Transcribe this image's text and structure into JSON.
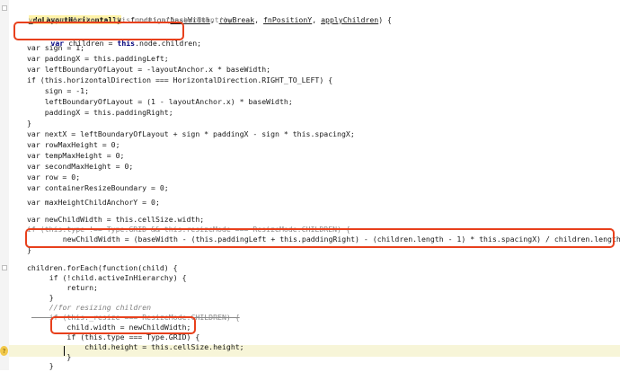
{
  "editor": {
    "lines": {
      "l1": "_doLayoutHorizontally",
      "l1_rest": ": function(",
      "l1_p1": "baseWidth",
      "l1_p2": "rowBreak",
      "l1_p3": "fnPositionY",
      "l1_p4": "applyChildren",
      "l1_end": ") {",
      "l2": "    var layoutAnchor = this.node.getAnchorPoint();",
      "l3a": "    var",
      "l3b": " children = ",
      "l3c": "this",
      "l3d": ".node.children;",
      "l5": "var sign = 1;",
      "l6": "var paddingX = this.paddingLeft;",
      "l7": "var leftBoundaryOfLayout = -layoutAnchor.x * baseWidth;",
      "l8": "if (this.horizontalDirection === HorizontalDirection.RIGHT_TO_LEFT) {",
      "l9": "    sign = -1;",
      "l10": "    leftBoundaryOfLayout = (1 - layoutAnchor.x) * baseWidth;",
      "l11": "    paddingX = this.paddingRight;",
      "l12": "}",
      "l14": "var nextX = leftBoundaryOfLayout + sign * paddingX - sign * this.spacingX;",
      "l15": "var rowMaxHeight = 0;",
      "l16": "var tempMaxHeight = 0;",
      "l17": "var secondMaxHeight = 0;",
      "l18": "var row = 0;",
      "l19": "var containerResizeBoundary = 0;",
      "l21": "var maxHeightChildAnchorY = 0;",
      "l23": "var newChildWidth = this.cellSize.width;",
      "l24": "if (this.type !== Type.GRID && this.resizeMode === ResizeMode.CHILDREN) {",
      "l25": "    newChildWidth = (baseWidth - (this.paddingLeft + this.paddingRight) - (children.length - 1) * this.spacingX) / children.length;",
      "l26": "}",
      "l28": "children.forEach(function(child) {",
      "l29": "    if (!child.activeInHierarchy) {",
      "l30": "        return;",
      "l31": "    }",
      "l32": "    //for resizing children",
      "l33": "    if (this._resize === ResizeMode.CHILDREN) {",
      "l34": "        child.width = newChildWidth;",
      "l35": "        if (this.type === Type.GRID) {",
      "l36": "            child.height = this.cellSize.height;",
      "l37": "        }",
      "l38": "    }"
    },
    "gutter_marker": "?",
    "colors": {
      "highlight_box": "#e8401c",
      "current_line": "#f7f5d8",
      "keyword": "#000080",
      "field": "#5b0f9a",
      "number": "#0000ff",
      "comment": "#808080"
    }
  }
}
